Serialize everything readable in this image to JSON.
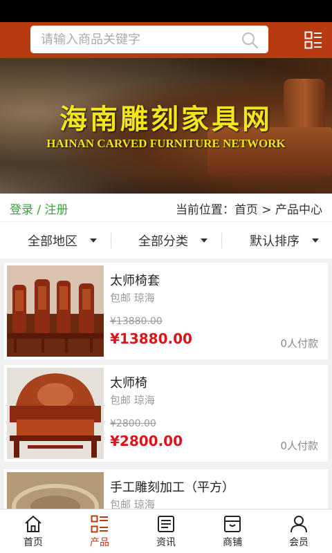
{
  "header": {
    "search_placeholder": "请输入商品关键字",
    "search_icon": "search-icon",
    "menu_icon": "menu-icon"
  },
  "banner": {
    "title": "海南雕刻家具网",
    "subtitle": "HAINAN CARVED FURNITURE NETWORK"
  },
  "crumbbar": {
    "login": "登录",
    "separator": " / ",
    "register": "注册",
    "location_label": "当前位置：",
    "home": "首页",
    "arrow": " > ",
    "current": "产品中心"
  },
  "filters": [
    {
      "label": "全部地区"
    },
    {
      "label": "全部分类"
    },
    {
      "label": "默认排序"
    }
  ],
  "products": [
    {
      "name": "太师椅套",
      "meta": "包邮 琼海",
      "old_price": "¥13880.00",
      "price": "¥13880.00",
      "sold": "0人付款"
    },
    {
      "name": "太师椅",
      "meta": "包邮 琼海",
      "old_price": "¥2800.00",
      "price": "¥2800.00",
      "sold": "0人付款"
    },
    {
      "name": "手工雕刻加工（平方）",
      "meta": "包邮 琼海",
      "old_price": "",
      "price": "",
      "sold": ""
    }
  ],
  "tabbar": [
    {
      "label": "首页",
      "icon": "home-icon",
      "active": false
    },
    {
      "label": "产品",
      "icon": "list-icon",
      "active": true
    },
    {
      "label": "资讯",
      "icon": "news-icon",
      "active": false
    },
    {
      "label": "商铺",
      "icon": "shop-icon",
      "active": false
    },
    {
      "label": "会员",
      "icon": "user-icon",
      "active": false
    }
  ],
  "colors": {
    "brand": "#b83a10",
    "price": "#d8161b",
    "login": "#37a33b",
    "banner_text": "#f2e51a"
  }
}
